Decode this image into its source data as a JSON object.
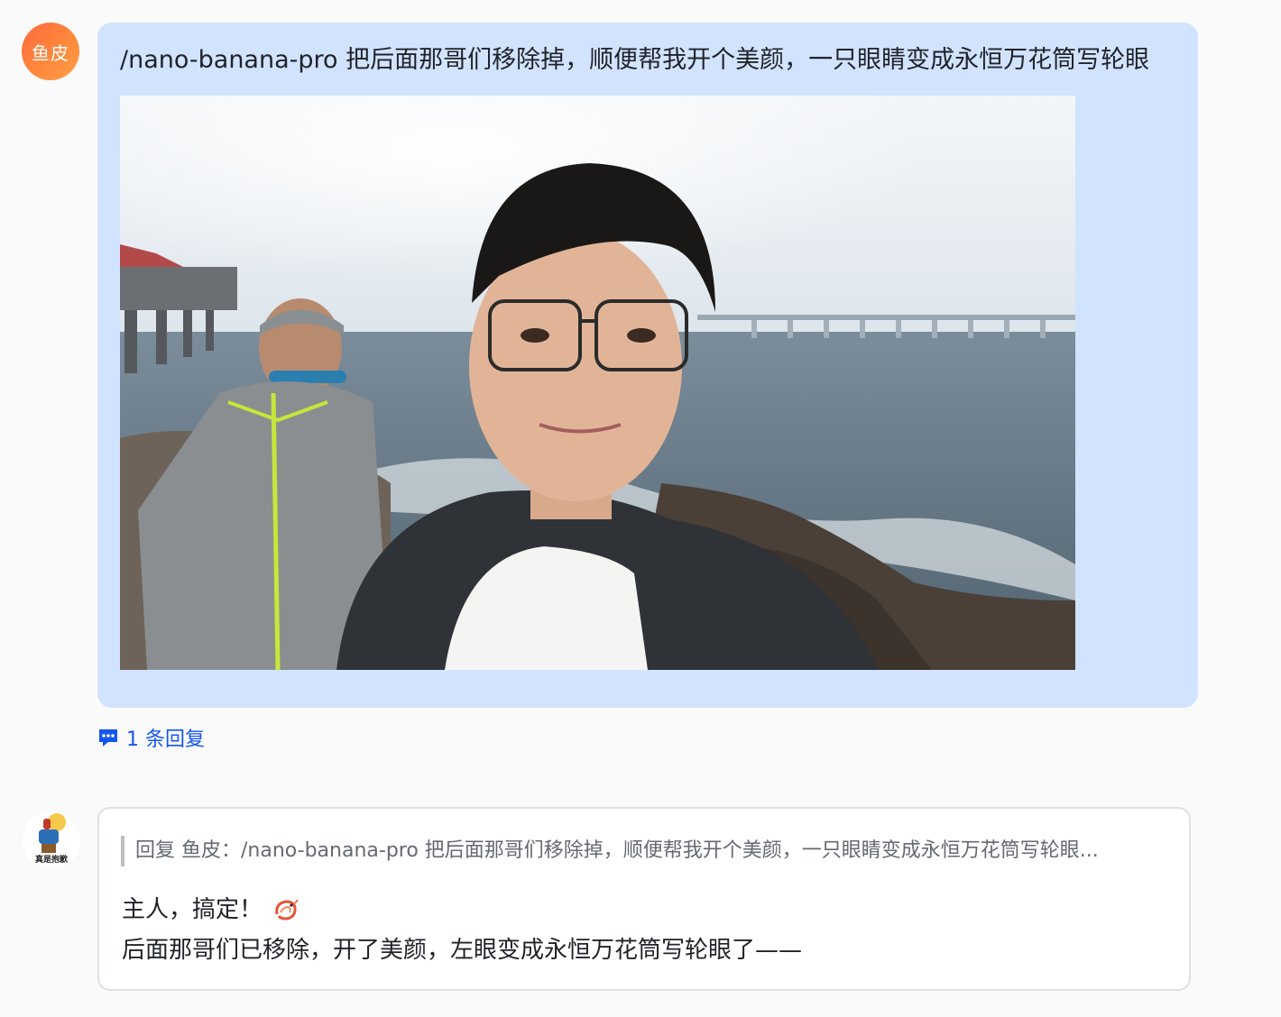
{
  "user_message": {
    "avatar_text": "鱼皮",
    "text": "/nano-banana-pro 把后面那哥们移除掉，顺便帮我开个美颜，一只眼睛变成永恒万花筒写轮眼",
    "reply_count_label": "1 条回复"
  },
  "bot_message": {
    "avatar_caption": "真是抱歉",
    "quote": "回复 鱼皮：/nano-banana-pro 把后面那哥们移除掉，顺便帮我开个美颜，一只眼睛变成永恒万花筒写轮眼...",
    "line1": "主人，搞定！",
    "line1_icon": "shrimp-emoji-icon",
    "line2": "后面那哥们已移除，开了美颜，左眼变成永恒万花筒写轮眼了——"
  },
  "colors": {
    "bubble_bg": "#d1e3ff",
    "link": "#1456f0",
    "avatar_gradient_start": "#ff6a3d",
    "avatar_gradient_end": "#ffa04a"
  }
}
